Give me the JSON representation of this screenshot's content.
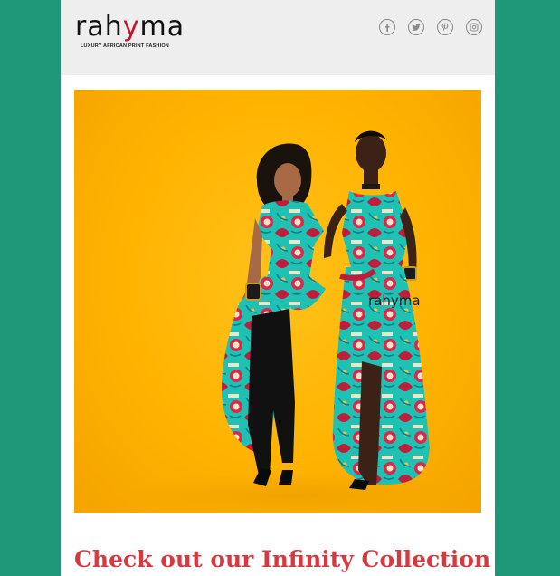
{
  "brand": {
    "logo_prefix": "rah",
    "logo_accent": "y",
    "logo_suffix": "ma",
    "tagline": "LUXURY AFRICAN PRINT FASHION",
    "accent_color": "#c8102e"
  },
  "social": [
    {
      "name": "facebook-icon",
      "glyph": "f"
    },
    {
      "name": "twitter-icon",
      "glyph": "bird"
    },
    {
      "name": "pinterest-icon",
      "glyph": "p"
    },
    {
      "name": "instagram-icon",
      "glyph": "camera"
    }
  ],
  "hero": {
    "watermark": "rahyma",
    "background_color": "#ffb300"
  },
  "headline": "Check out our Infinity Collection",
  "colors": {
    "page_background": "#1e9878",
    "header_background": "#eeeeee",
    "headline": "#d8393f"
  }
}
